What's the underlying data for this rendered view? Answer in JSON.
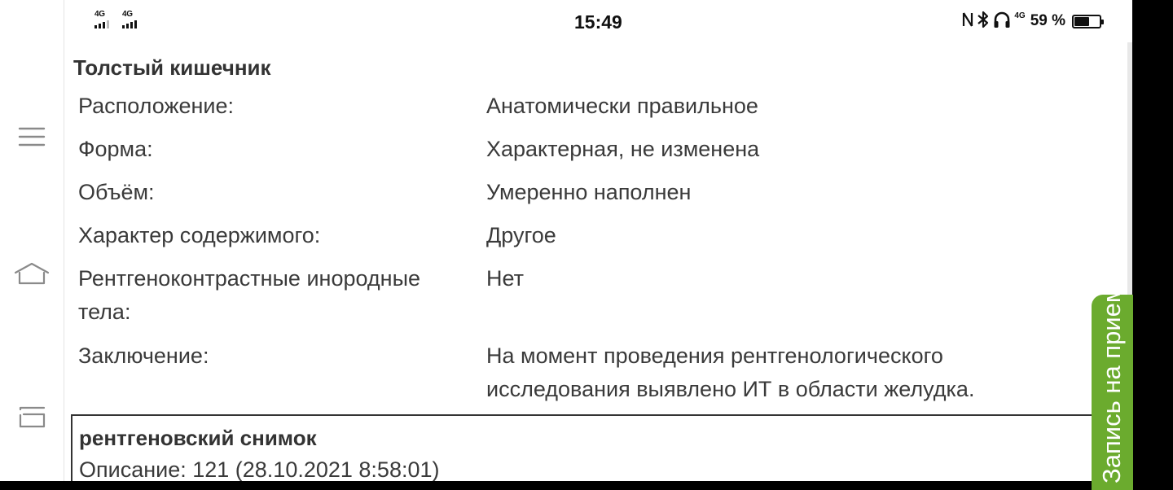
{
  "status_bar": {
    "network_left": [
      "4G",
      "4G"
    ],
    "time": "15:49",
    "network_right": "4G",
    "battery_percent": "59 %",
    "battery_level": 0.59,
    "icons": [
      "nfc-icon",
      "bluetooth-icon",
      "headphones-icon"
    ]
  },
  "nav": {
    "icons": [
      "menu-icon",
      "home-icon",
      "back-icon"
    ]
  },
  "section": {
    "title": "Толстый кишечник",
    "rows": [
      {
        "label": "Расположение:",
        "value": "Анатомически правильное"
      },
      {
        "label": "Форма:",
        "value": "Характерная, не изменена"
      },
      {
        "label": "Объём:",
        "value": "Умеренно наполнен"
      },
      {
        "label": "Характер содержимого:",
        "value": "Другое"
      },
      {
        "label": "Рентгеноконтрастные инородные тела:",
        "value": "Нет"
      },
      {
        "label": "Заключение:",
        "value": "На момент проведения рентгенологического исследования выявлено ИТ в области желудка."
      }
    ]
  },
  "xray": {
    "title": "рентгеновский снимок",
    "description": "Описание: 121 (28.10.2021 8:58:01)"
  },
  "appointment_tab": {
    "label": "Запись на прием",
    "color": "#6bab2e"
  }
}
